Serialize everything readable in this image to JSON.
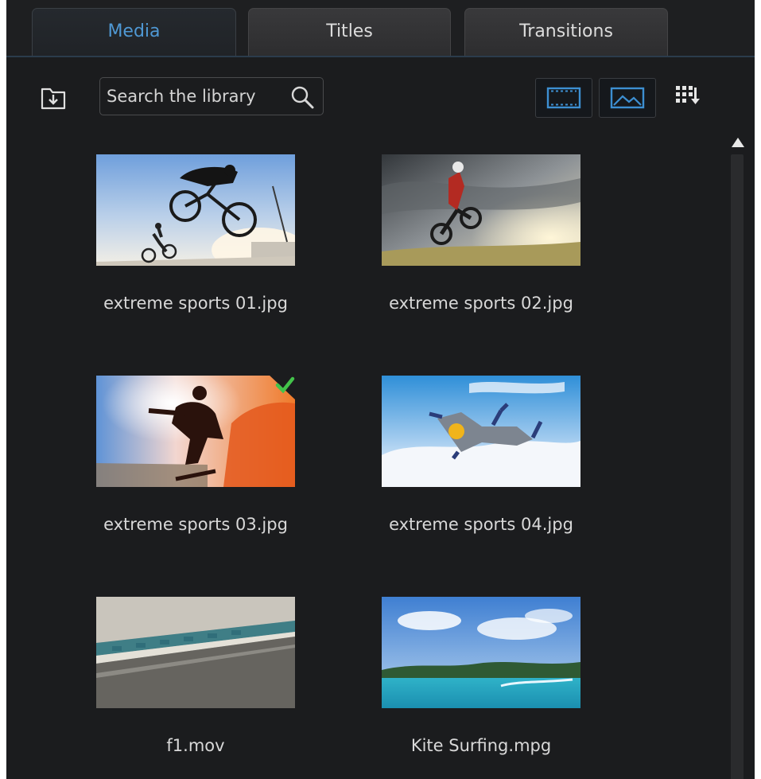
{
  "tabs": [
    {
      "label": "Media",
      "active": true
    },
    {
      "label": "Titles",
      "active": false
    },
    {
      "label": "Transitions",
      "active": false
    }
  ],
  "toolbar": {
    "import_icon": "import-media-icon",
    "search_placeholder": "Search the library",
    "search_icon": "search-icon",
    "view_buttons": [
      "filmstrip-view-icon",
      "image-view-icon"
    ],
    "sort_icon": "sort-grid-icon"
  },
  "library": {
    "items": [
      {
        "name": "extreme sports 01.jpg",
        "selected": false
      },
      {
        "name": "extreme sports 02.jpg",
        "selected": false
      },
      {
        "name": "extreme sports 03.jpg",
        "selected": true
      },
      {
        "name": "extreme sports 04.jpg",
        "selected": false
      },
      {
        "name": "f1.mov",
        "selected": false
      },
      {
        "name": "Kite Surfing.mpg",
        "selected": false
      }
    ]
  },
  "colors": {
    "panel_bg": "#1b1c1e",
    "active_tab_text": "#4f98d4",
    "accent_check": "#43c24a"
  }
}
